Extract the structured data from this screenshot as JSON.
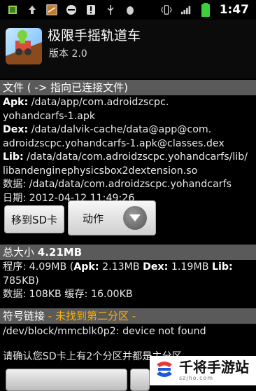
{
  "status_bar": {
    "time": "1:47",
    "left_icons": [
      "app-icon",
      "upload-icon",
      "game-icon",
      "no-entry-icon",
      "alert-icon",
      "usb-icon",
      "debug-icon"
    ],
    "right_icons": [
      "vibrate-icon",
      "signal-icon",
      "battery-icon"
    ],
    "battery_color": "#3ad13a"
  },
  "header": {
    "title": "极限手摇轨道车",
    "version": "版本 2.0"
  },
  "files_section": {
    "label": "文件",
    "accent": "( -> 指向已连接文件)"
  },
  "file_info": {
    "apk_key": "Apk:",
    "apk_line1": " /data/app/com.adroidzscpc.",
    "apk_line2": "yohandcarfs-1.apk",
    "dex_key": "Dex:",
    "dex_line1": " /data/dalvik-cache/data@app@com.",
    "dex_line2": "adroidzscpc.yohandcarfs-1.apk@classes.dex",
    "lib_key": "Lib:",
    "lib_line1": " /data/data/com.adroidzscpc.yohandcarfs/lib/",
    "lib_line2": "libandenginephysicsbox2dextension.so",
    "data_line": "数据: /data/data/com.adroidzscpc.yohandcarfs",
    "date_line": "日期: 2012-04-12 11:49:26"
  },
  "buttons": {
    "move_sd": "移到SD卡",
    "action": "动作"
  },
  "size_section": {
    "label": "总大小",
    "value": "4.21MB"
  },
  "size_info": {
    "program_prefix": "程序: 4.09MB (",
    "apk_key": "Apk:",
    "apk_val": " 2.13MB ",
    "dex_key": "Dex:",
    "dex_val": " 1.19MB ",
    "lib_key": "Lib:",
    "lib_val": "785KB)",
    "data_line": "数据: 108KB 缓存: 16.00KB"
  },
  "symlink_section": {
    "label": "符号链接",
    "accent": " - 未找到第二分区 -"
  },
  "symlink_info": {
    "device_line": "/dev/block/mmcblk0p2: device not found",
    "hint_line": "请确认您SD卡上有2个分区并都是主分区"
  },
  "watermark": {
    "title": "千将手游站",
    "url": "szjho.com"
  },
  "colors": {
    "accent": "#ffb100",
    "section_bar": "#5a5a5a",
    "background": "#000000"
  }
}
